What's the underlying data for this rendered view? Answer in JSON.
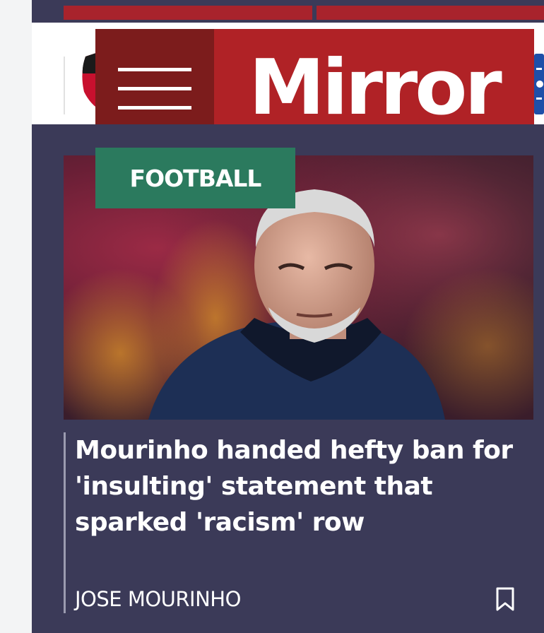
{
  "header": {
    "logo_text": "Mirror",
    "menu_icon": "hamburger-menu-icon"
  },
  "article": {
    "category": "FOOTBALL",
    "headline": "Mourinho handed hefty ban for 'insulting' statement that sparked 'racism' row",
    "topic": "JOSE MOURINHO",
    "bookmark_icon": "bookmark-icon"
  },
  "colors": {
    "brand_red": "#b02226",
    "menu_dark_red": "#7c1c1c",
    "card_background": "#3b3a58",
    "category_green": "#2b7a5e",
    "text_white": "#ffffff"
  }
}
